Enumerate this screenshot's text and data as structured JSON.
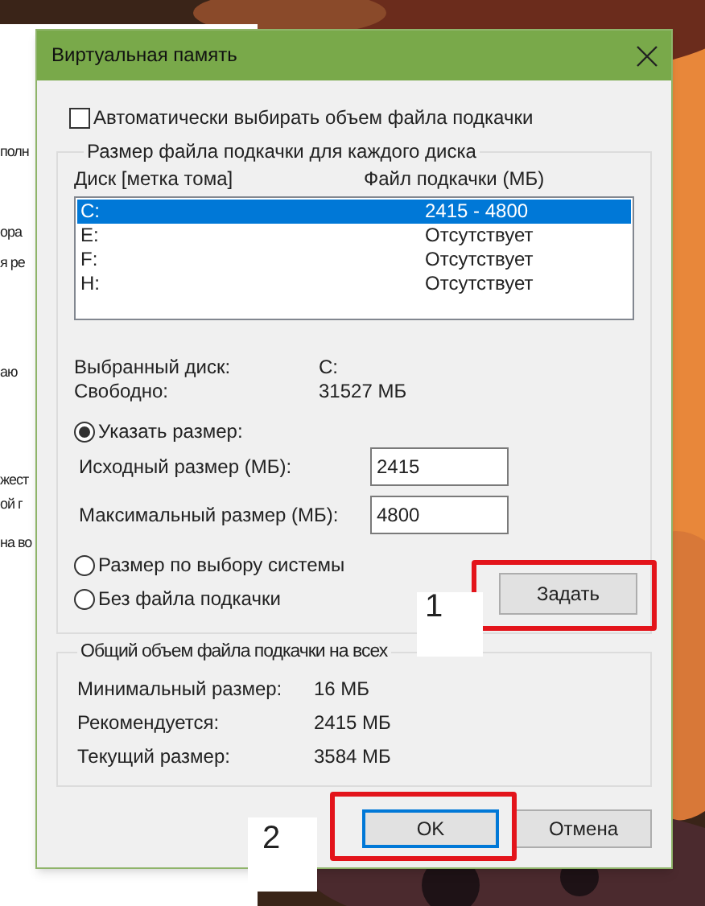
{
  "background_window": {
    "fragments": [
      "полн",
      "ора",
      "я ре",
      "аю",
      "жест",
      "ой г",
      "на во"
    ]
  },
  "dialog": {
    "title": "Виртуальная память",
    "auto_manage": {
      "label": "Автоматически выбирать объем файла подкачки",
      "checked": false
    },
    "per_drive": {
      "legend": "Размер файла подкачки для каждого диска",
      "columns": [
        "Диск [метка тома]",
        "Файл подкачки (МБ)"
      ],
      "drives": [
        {
          "drive": "C:",
          "paging_file": "2415 - 4800",
          "selected": true
        },
        {
          "drive": "E:",
          "paging_file": "Отсутствует",
          "selected": false
        },
        {
          "drive": "F:",
          "paging_file": "Отсутствует",
          "selected": false
        },
        {
          "drive": "H:",
          "paging_file": "Отсутствует",
          "selected": false
        }
      ],
      "selected_drive": {
        "label": "Выбранный диск:",
        "value": "C:"
      },
      "free": {
        "label": "Свободно:",
        "value": "31527 МБ"
      },
      "options": [
        {
          "label": "Указать размер:",
          "selected": true
        },
        {
          "label": "Размер по выбору системы",
          "selected": false
        },
        {
          "label": "Без файла подкачки",
          "selected": false
        }
      ],
      "initial_size": {
        "label": "Исходный размер (МБ):",
        "value": "2415"
      },
      "maximum_size": {
        "label": "Максимальный размер (МБ):",
        "value": "4800"
      },
      "set_button": "Задать"
    },
    "total": {
      "legend": "Общий объем файла подкачки на всех",
      "rows": [
        {
          "label": "Минимальный размер:",
          "value": "16 МБ"
        },
        {
          "label": "Рекомендуется:",
          "value": "2415 МБ"
        },
        {
          "label": "Текущий размер:",
          "value": "3584 МБ"
        }
      ]
    },
    "buttons": [
      {
        "label": "OK",
        "focused": true
      },
      {
        "label": "Отмена",
        "focused": false
      }
    ]
  },
  "annotations": [
    {
      "label": "1"
    },
    {
      "label": "2"
    }
  ]
}
